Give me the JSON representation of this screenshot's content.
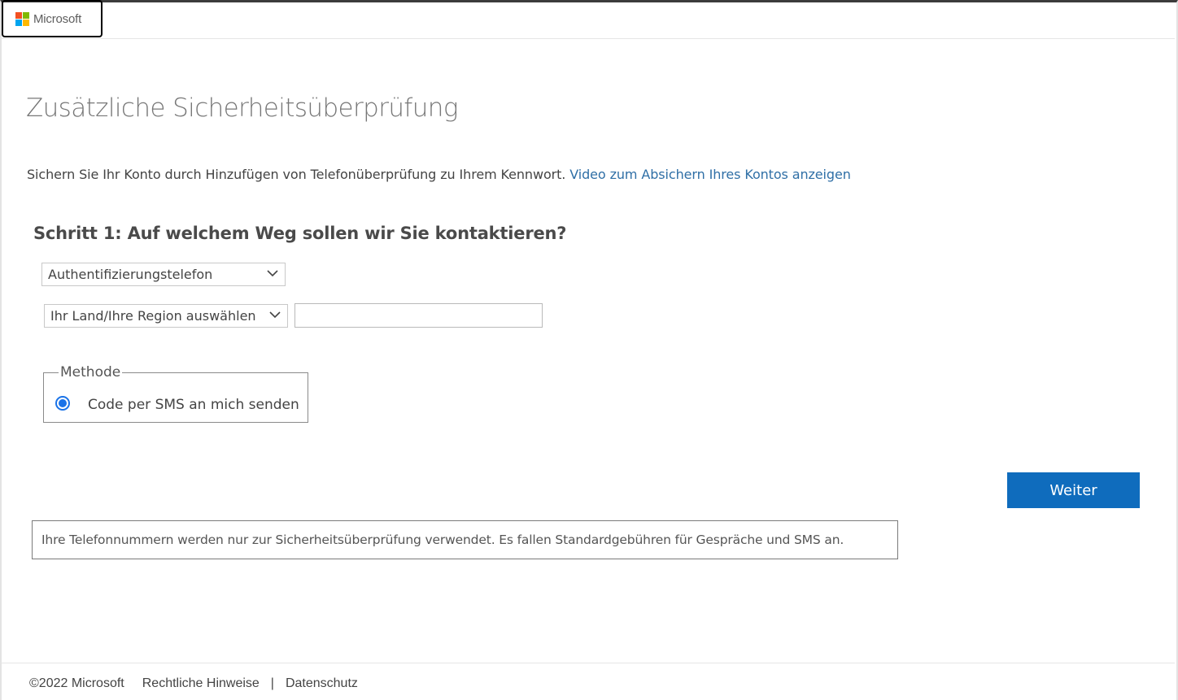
{
  "header": {
    "logo_text": "Microsoft",
    "logo_colors": [
      "#f25022",
      "#7fba00",
      "#00a4ef",
      "#ffb900"
    ]
  },
  "page": {
    "title": "Zusätzliche Sicherheitsüberprüfung",
    "intro_text": "Sichern Sie Ihr Konto durch Hinzufügen von Telefonüberprüfung zu Ihrem Kennwort. ",
    "intro_link": "Video zum Absichern Ihres Kontos anzeigen",
    "step_heading": "Schritt 1: Auf welchem Weg sollen wir Sie kontaktieren?"
  },
  "form": {
    "contact_method_selected": "Authentifizierungstelefon",
    "country_selected": "Ihr Land/Ihre Region auswählen",
    "phone_value": "",
    "method_legend": "Methode",
    "method_option_label": "Code per SMS an mich senden",
    "method_option_checked": true,
    "next_label": "Weiter"
  },
  "notice": {
    "text": "Ihre Telefonnummern werden nur zur Sicherheitsüberprüfung verwendet. Es fallen Standardgebühren für Gespräche und SMS an."
  },
  "footer": {
    "copyright": "©2022 Microsoft",
    "legal": "Rechtliche Hinweise",
    "separator": "|",
    "privacy": "Datenschutz"
  },
  "colors": {
    "accent": "#0f6cbd",
    "link": "#2f6fa6",
    "radio": "#1a73e8"
  }
}
